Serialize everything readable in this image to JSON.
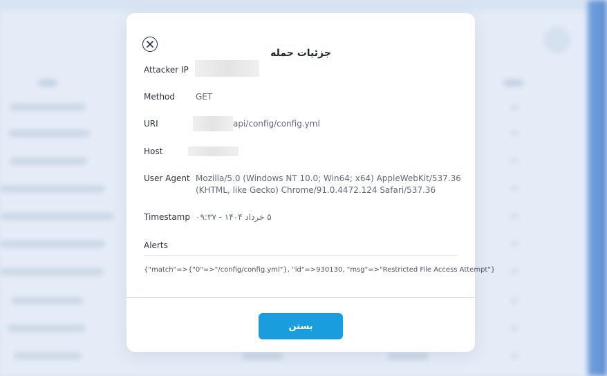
{
  "modal": {
    "title": "جزئیات حمله",
    "close_icon": "close-icon",
    "fields": {
      "attacker_ip": {
        "label": "Attacker IP",
        "value": ""
      },
      "method": {
        "label": "Method",
        "value": "GET"
      },
      "uri": {
        "label": "URI",
        "value": "api/config/config.yml"
      },
      "host": {
        "label": "Host",
        "value": ""
      },
      "user_agent": {
        "label": "User Agent",
        "line1": "Mozilla/5.0 (Windows NT 10.0; Win64; x64) AppleWebKit/537.36",
        "line2": "(KHTML, like Gecko) Chrome/91.0.4472.124 Safari/537.36"
      },
      "timestamp": {
        "label": "Timestamp",
        "value": "۵ خرداد ۱۴۰۴ - ۰۹:۳۷"
      }
    },
    "alerts": {
      "label": "Alerts",
      "text": "{\"match\"=>{\"0\"=>\"/config/config.yml\"}, \"id\"=>930130, \"msg\"=>\"Restricted File Access Attempt\"}"
    },
    "close_button_label": "بستن"
  },
  "colors": {
    "primary": "#1a9ddf",
    "overlay": "#d6e2f2",
    "modal_bg": "#ffffff"
  }
}
